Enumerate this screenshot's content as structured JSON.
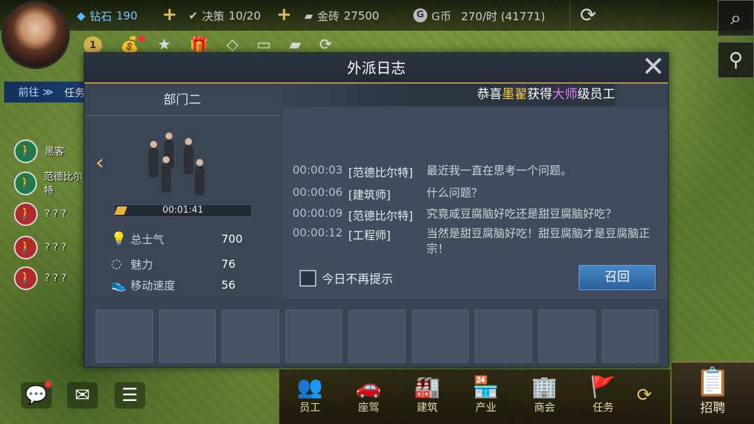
{
  "topbar": {
    "diamond_label": "钻石",
    "diamond_value": "190",
    "decision_label": "决策",
    "decision_value": "10/20",
    "gold_label": "金砖",
    "gold_value": "27500",
    "gcoin_label": "G币",
    "gcoin_value": "270/时 (41771)",
    "plus": "+"
  },
  "quick_badge": "1",
  "goto": {
    "label": "前往 ≫",
    "task": "任务"
  },
  "members": [
    {
      "name": "黑客",
      "icon": "walking-person-icon",
      "color": "#1f7a4a"
    },
    {
      "name": "范德比尔特",
      "icon": "walking-person-icon",
      "color": "#1f7a4a"
    },
    {
      "name": "? ? ?",
      "icon": "walking-person-icon",
      "color": "#b02a2a"
    },
    {
      "name": "? ? ?",
      "icon": "walking-person-icon",
      "color": "#b02a2a"
    },
    {
      "name": "? ? ?",
      "icon": "walking-person-icon",
      "color": "#b02a2a"
    }
  ],
  "dialog": {
    "title": "外派日志",
    "marquee": {
      "prefix": "恭喜",
      "name": "墨翟",
      "mid": "获得",
      "rank": "大师",
      "suffix": "级员工"
    },
    "department": "部门二",
    "timer": "00:01:41",
    "stats": [
      {
        "label": "总士气",
        "value": "700",
        "icon": "lightbulb-icon"
      },
      {
        "label": "魅力",
        "value": "76",
        "icon": "charm-ring-icon"
      },
      {
        "label": "移动速度",
        "value": "56",
        "icon": "shoe-icon"
      }
    ],
    "logs": [
      {
        "time": "00:00:03",
        "role": "[范德比尔特]",
        "msg": "最近我一直在思考一个问题。"
      },
      {
        "time": "00:00:06",
        "role": "[建筑师]",
        "msg": "什么问题？"
      },
      {
        "time": "00:00:09",
        "role": "[范德比尔特]",
        "msg": "究竟咸豆腐脑好吃还是甜豆腐脑好吃？"
      },
      {
        "time": "00:00:12",
        "role": "[工程师]",
        "msg": "当然是甜豆腐脑好吃！甜豆腐脑才是豆腐脑正宗！"
      }
    ],
    "checkbox_label": "今日不再提示",
    "recall_label": "召回"
  },
  "bottom_nav": [
    {
      "label": "员工",
      "icon": "employee-icon"
    },
    {
      "label": "座驾",
      "icon": "car-icon"
    },
    {
      "label": "建筑",
      "icon": "factory-icon"
    },
    {
      "label": "产业",
      "icon": "shop-icon"
    },
    {
      "label": "商会",
      "icon": "building-icon"
    },
    {
      "label": "任务",
      "icon": "task-flag-icon"
    }
  ],
  "recruit_label": "招聘",
  "colors": {
    "accent": "#b79a49",
    "recall": "#3b76b8",
    "highlight_yellow": "#ffd23a",
    "highlight_purple": "#e07bff"
  }
}
